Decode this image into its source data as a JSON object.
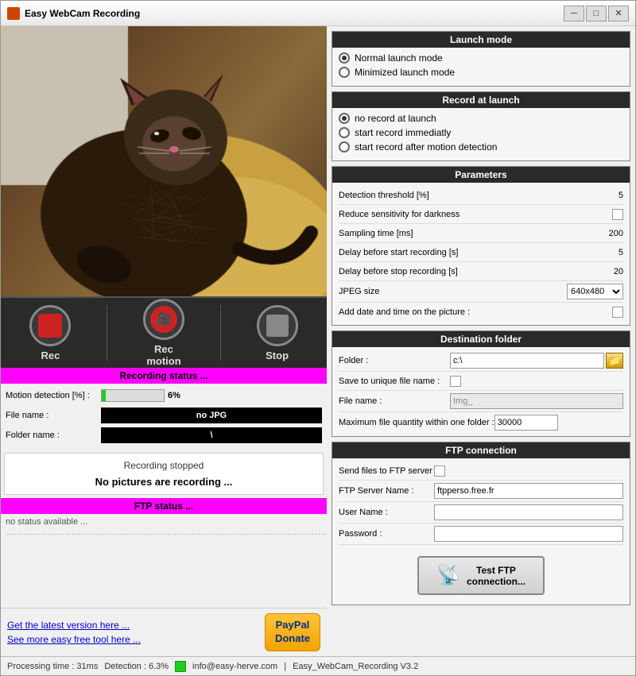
{
  "window": {
    "title": "Easy WebCam Recording",
    "min_label": "─",
    "max_label": "□",
    "close_label": "✕"
  },
  "controls": {
    "rec_label": "Rec",
    "recmotion_label": "Rec\nmotion",
    "stop_label": "Stop"
  },
  "recording_status": {
    "header": "Recording status ...",
    "motion_label": "Motion detection [%] :",
    "motion_value": "6%",
    "filename_label": "File name :",
    "filename_value": "no JPG",
    "foldername_label": "Folder name :",
    "foldername_value": "\\",
    "stopped_title": "Recording stopped",
    "stopped_msg": "No pictures are recording ..."
  },
  "ftp_status": {
    "header": "FTP status ...",
    "status_text": "no status available ...",
    "dots": "............................................................................................................"
  },
  "links": {
    "latest_version": "Get the latest version here ...",
    "more_tools": "See more easy free tool here ...",
    "paypal_line1": "PayPal",
    "paypal_line2": "Donate"
  },
  "status_bar": {
    "processing": "Processing time : 31ms",
    "detection": "Detection : 6.3%",
    "email": "info@easy-herve.com",
    "version": "Easy_WebCam_Recording V3.2"
  },
  "launch_mode": {
    "title": "Launch mode",
    "options": [
      {
        "label": "Normal launch mode",
        "checked": true
      },
      {
        "label": "Minimized launch mode",
        "checked": false
      }
    ]
  },
  "record_at_launch": {
    "title": "Record at launch",
    "options": [
      {
        "label": "no record at launch",
        "checked": true
      },
      {
        "label": "start record immediatly",
        "checked": false
      },
      {
        "label": "start record after motion detection",
        "checked": false
      }
    ]
  },
  "parameters": {
    "title": "Parameters",
    "rows": [
      {
        "label": "Detection threshold [%]",
        "value": "5",
        "type": "text"
      },
      {
        "label": "Reduce sensitivity for darkness",
        "value": "",
        "type": "checkbox"
      },
      {
        "label": "Sampling time [ms]",
        "value": "200",
        "type": "text"
      },
      {
        "label": "Delay before start recording [s]",
        "value": "5",
        "type": "text"
      },
      {
        "label": "Delay before stop recording [s]",
        "value": "20",
        "type": "text"
      },
      {
        "label": "JPEG size",
        "value": "640x480",
        "type": "select"
      },
      {
        "label": "Add date and time on the picture :",
        "value": "",
        "type": "checkbox"
      }
    ]
  },
  "destination_folder": {
    "title": "Destination folder",
    "folder_label": "Folder :",
    "folder_value": "c:\\",
    "unique_label": "Save to unique file name :",
    "filename_label": "File name :",
    "filename_value": "Img_",
    "max_label": "Maximum file quantity within one folder :",
    "max_value": "30000"
  },
  "ftp_connection": {
    "title": "FTP connection",
    "send_label": "Send files to FTP server",
    "server_label": "FTP Server Name :",
    "server_value": "ftpperso.free.fr",
    "user_label": "User Name :",
    "user_value": "",
    "pass_label": "Password :",
    "pass_value": "",
    "test_btn": "Test FTP\nconnection..."
  }
}
